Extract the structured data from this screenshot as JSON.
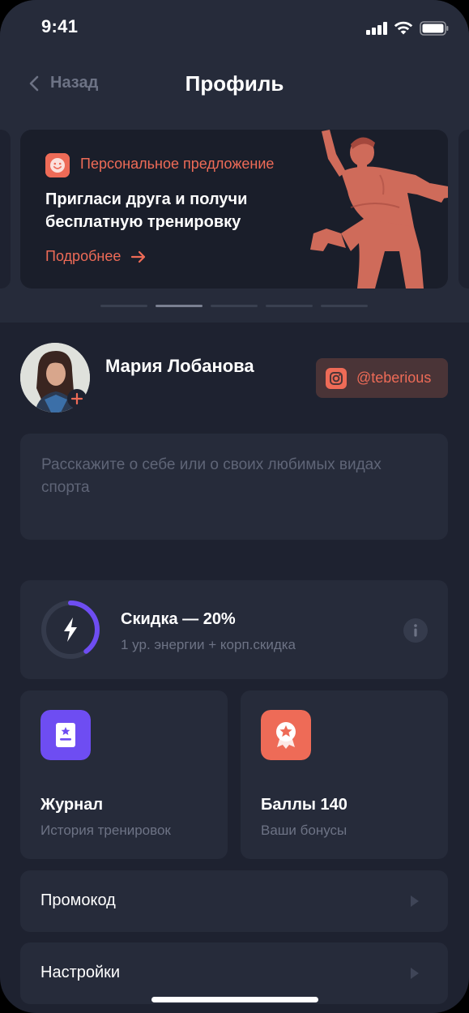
{
  "status_bar": {
    "time": "9:41"
  },
  "nav": {
    "back_label": "Назад",
    "title": "Профиль"
  },
  "banner": {
    "label": "Персональное предложение",
    "title": "Пригласи друга и получи бесплатную тренировку",
    "link": "Подробнее",
    "icon": "smile-icon",
    "carousel_count": 5,
    "active_index": 1
  },
  "profile": {
    "name": "Мария Лобанова",
    "instagram": "@teberious",
    "bio_placeholder": "Расскажите о себе или о своих любимых видах спорта"
  },
  "discount": {
    "title": "Скидка — 20%",
    "subtitle": "1 ур. энергии + корп.скидка",
    "energy_level": 0.4
  },
  "tiles": [
    {
      "title": "Журнал",
      "subtitle": "История тренировок",
      "icon": "journal-icon",
      "color": "#6e4df2"
    },
    {
      "title": "Баллы 140",
      "subtitle": "Ваши бонусы",
      "icon": "star-badge-icon",
      "color": "#ee6b57"
    }
  ],
  "menu": [
    {
      "label": "Промокод"
    },
    {
      "label": "Настройки"
    }
  ],
  "colors": {
    "accent": "#ee6b57",
    "background": "#1e2230",
    "card": "#262b3a",
    "purple": "#6e4df2"
  }
}
